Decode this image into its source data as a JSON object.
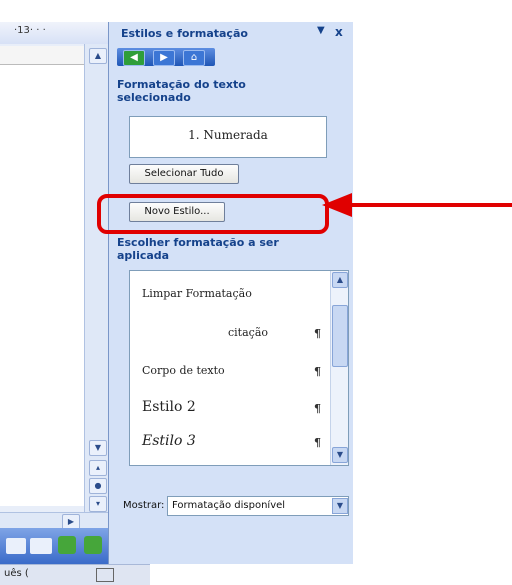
{
  "word": {
    "zoom_text": "·13· ·  · ",
    "status_text": "uês (   "
  },
  "pane": {
    "title": "Estilos e formatação",
    "menu_glyph": "▼",
    "close_glyph": "x",
    "selected_heading": "Formatação do texto selecionado",
    "selected_value": "1. Numerada",
    "select_all_label": "Selecionar Tudo",
    "new_style_label": "Novo Estilo...",
    "choose_heading": "Escolher formatação a ser aplicada",
    "styles": [
      {
        "label": "Limpar Formatação",
        "mark": ""
      },
      {
        "label": "citação",
        "mark": "¶"
      },
      {
        "label": "Corpo de texto",
        "mark": "¶"
      },
      {
        "label": "Estilo 2",
        "mark": "¶"
      },
      {
        "label": "Estilo 3",
        "mark": "¶"
      }
    ],
    "show_label": "Mostrar:",
    "show_value": "Formatação disponível"
  },
  "colors": {
    "pane_bg": "#d4e1f7",
    "heading": "#15428b",
    "highlight": "#e00000"
  },
  "icons": [
    "back-icon",
    "forward-icon",
    "home-icon",
    "scroll-up-icon",
    "scroll-down-icon",
    "pilcrow-icon",
    "red-arrow-icon"
  ]
}
